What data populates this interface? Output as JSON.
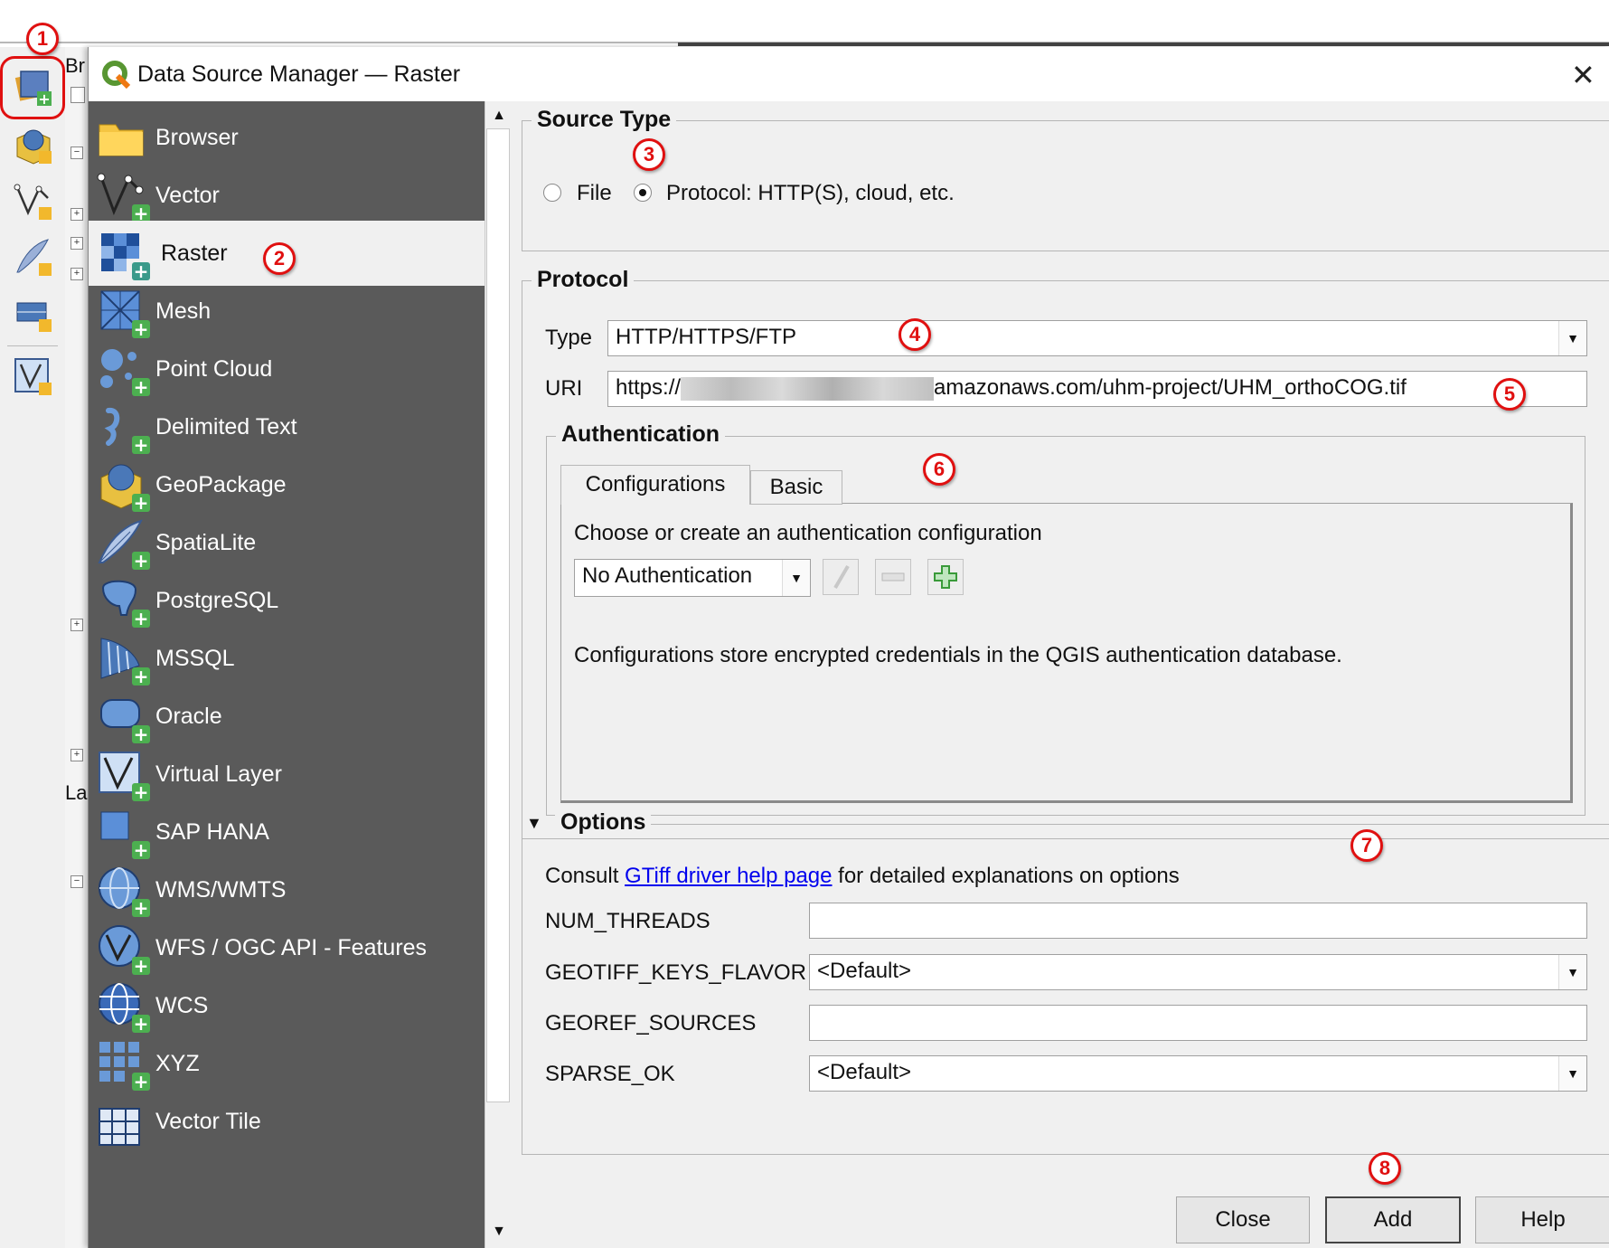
{
  "window": {
    "title": "Data Source Manager — Raster",
    "close_glyph": "✕"
  },
  "background": {
    "left_toolbar_icons": [
      "open-data-source-manager-icon",
      "geopackage-layer-icon",
      "vector-layer-icon",
      "spatialite-layer-icon",
      "mesh-layer-icon",
      "virtual-layer-icon"
    ],
    "panel_fragments": [
      "Br",
      "La"
    ]
  },
  "sidebar": {
    "items": [
      {
        "label": "Browser",
        "icon": "folder-icon"
      },
      {
        "label": "Vector",
        "icon": "vector-icon"
      },
      {
        "label": "Raster",
        "icon": "raster-icon",
        "selected": true
      },
      {
        "label": "Mesh",
        "icon": "mesh-icon"
      },
      {
        "label": "Point Cloud",
        "icon": "point-cloud-icon"
      },
      {
        "label": "Delimited Text",
        "icon": "delimited-text-icon"
      },
      {
        "label": "GeoPackage",
        "icon": "geopackage-icon"
      },
      {
        "label": "SpatiaLite",
        "icon": "spatialite-icon"
      },
      {
        "label": "PostgreSQL",
        "icon": "postgresql-icon"
      },
      {
        "label": "MSSQL",
        "icon": "mssql-icon"
      },
      {
        "label": "Oracle",
        "icon": "oracle-icon"
      },
      {
        "label": "Virtual Layer",
        "icon": "virtual-layer-icon"
      },
      {
        "label": "SAP HANA",
        "icon": "sap-hana-icon"
      },
      {
        "label": "WMS/WMTS",
        "icon": "wms-icon"
      },
      {
        "label": "WFS / OGC API - Features",
        "icon": "wfs-icon"
      },
      {
        "label": "WCS",
        "icon": "wcs-icon"
      },
      {
        "label": "XYZ",
        "icon": "xyz-icon"
      },
      {
        "label": "Vector Tile",
        "icon": "vector-tile-icon"
      }
    ]
  },
  "source_type": {
    "title": "Source Type",
    "file_label": "File",
    "protocol_label": "Protocol: HTTP(S), cloud, etc.",
    "selected": "protocol"
  },
  "protocol": {
    "title": "Protocol",
    "type_label": "Type",
    "type_value": "HTTP/HTTPS/FTP",
    "uri_label": "URI",
    "uri_prefix": "https://",
    "uri_suffix": "amazonaws.com/uhm-project/UHM_orthoCOG.tif"
  },
  "authentication": {
    "title": "Authentication",
    "tabs": [
      "Configurations",
      "Basic"
    ],
    "active_tab": "Configurations",
    "choose_text": "Choose or create an authentication configuration",
    "auth_value": "No Authentication",
    "info_text": "Configurations store encrypted credentials in the QGIS authentication database."
  },
  "options": {
    "title": "Options",
    "consult_prefix": "Consult ",
    "link_text": "GTiff driver help page",
    "consult_suffix": " for detailed explanations on options",
    "fields": [
      {
        "label": "NUM_THREADS",
        "kind": "text",
        "value": ""
      },
      {
        "label": "GEOTIFF_KEYS_FLAVOR",
        "kind": "combo",
        "value": "<Default>"
      },
      {
        "label": "GEOREF_SOURCES",
        "kind": "text",
        "value": ""
      },
      {
        "label": "SPARSE_OK",
        "kind": "combo",
        "value": "<Default>"
      }
    ]
  },
  "buttons": {
    "close": "Close",
    "add": "Add",
    "help": "Help"
  },
  "markers": [
    "1",
    "2",
    "3",
    "4",
    "5",
    "6",
    "7",
    "8"
  ],
  "colors": {
    "sidebar_bg": "#5a5a5a",
    "marker_red": "#e01010",
    "link_blue": "#0000ee",
    "plus_green": "#4caf50"
  }
}
